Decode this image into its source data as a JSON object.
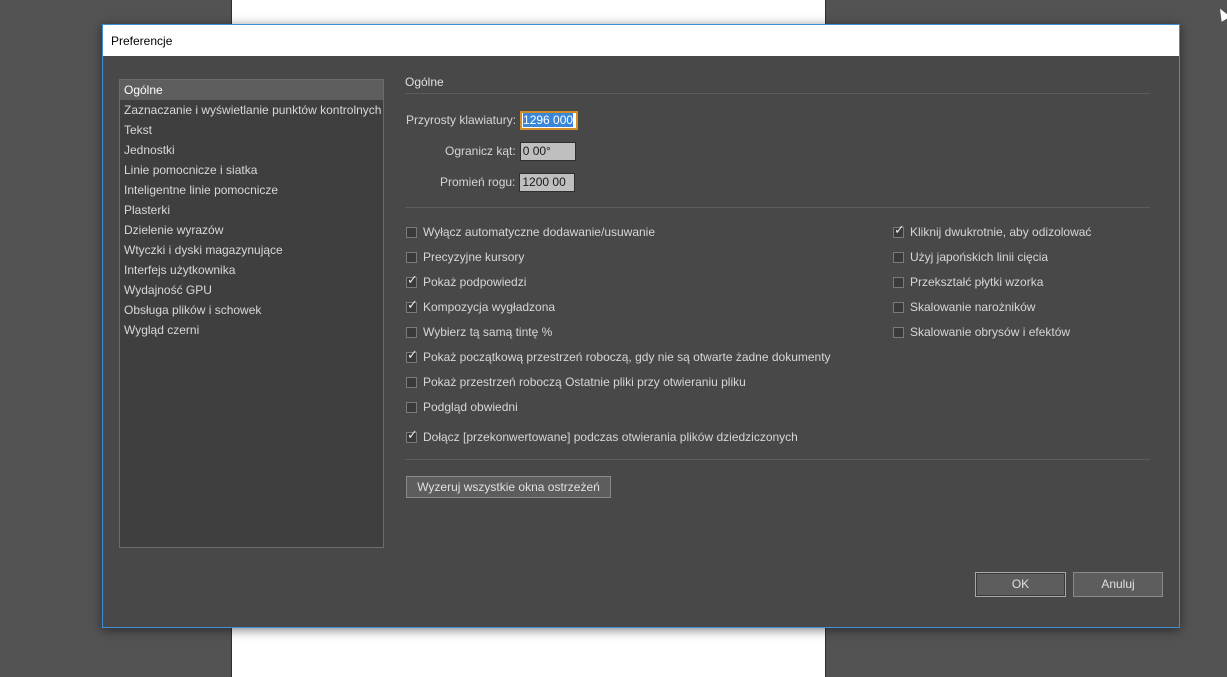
{
  "dialog": {
    "title": "Preferencje"
  },
  "sidebar": {
    "items": [
      {
        "label": "Ogólne",
        "selected": true
      },
      {
        "label": "Zaznaczanie i wyświetlanie punktów kontrolnych",
        "selected": false
      },
      {
        "label": "Tekst",
        "selected": false
      },
      {
        "label": "Jednostki",
        "selected": false
      },
      {
        "label": "Linie pomocnicze i siatka",
        "selected": false
      },
      {
        "label": "Inteligentne linie pomocnicze",
        "selected": false
      },
      {
        "label": "Plasterki",
        "selected": false
      },
      {
        "label": "Dzielenie wyrazów",
        "selected": false
      },
      {
        "label": "Wtyczki i dyski magazynujące",
        "selected": false
      },
      {
        "label": "Interfejs użytkownika",
        "selected": false
      },
      {
        "label": "Wydajność GPU",
        "selected": false
      },
      {
        "label": "Obsługa plików i schowek",
        "selected": false
      },
      {
        "label": "Wygląd czerni",
        "selected": false
      }
    ]
  },
  "general": {
    "section_title": "Ogólne",
    "keyboard_increment": {
      "label": "Przyrosty klawiatury:",
      "value": "1296 000"
    },
    "constrain_angle": {
      "label": "Ogranicz kąt:",
      "value": "0 00°"
    },
    "corner_radius": {
      "label": "Promień rogu:",
      "value": "1200 00"
    }
  },
  "checkboxes_left": [
    {
      "label": "Wyłącz automatyczne dodawanie/usuwanie",
      "checked": false
    },
    {
      "label": "Precyzyjne kursory",
      "checked": false
    },
    {
      "label": "Pokaż podpowiedzi",
      "checked": true
    },
    {
      "label": "Kompozycja wygładzona",
      "checked": true
    },
    {
      "label": "Wybierz tą samą tintę %",
      "checked": false
    },
    {
      "label": "Pokaż początkową przestrzeń roboczą, gdy nie są otwarte żadne dokumenty",
      "checked": true
    },
    {
      "label": "Pokaż przestrzeń roboczą Ostatnie pliki przy otwieraniu pliku",
      "checked": false
    },
    {
      "label": "Podgląd obwiedni",
      "checked": false
    },
    {
      "label": "Dołącz [przekonwertowane] podczas otwierania plików dziedziczonych",
      "checked": true
    }
  ],
  "checkboxes_right": [
    {
      "label": "Kliknij dwukrotnie, aby odizolować",
      "checked": true
    },
    {
      "label": "Użyj japońskich linii cięcia",
      "checked": false
    },
    {
      "label": "Przekształć płytki wzorka",
      "checked": false
    },
    {
      "label": "Skalowanie narożników",
      "checked": false
    },
    {
      "label": "Skalowanie obrysów i efektów",
      "checked": false
    }
  ],
  "buttons": {
    "reset_warnings": "Wyzeruj wszystkie okna ostrzeżeń",
    "ok": "OK",
    "cancel": "Anuluj"
  },
  "colors": {
    "accent_focus": "#d28c2a",
    "selection": "#3a86d8",
    "dialog_border": "#3c8fd9"
  }
}
